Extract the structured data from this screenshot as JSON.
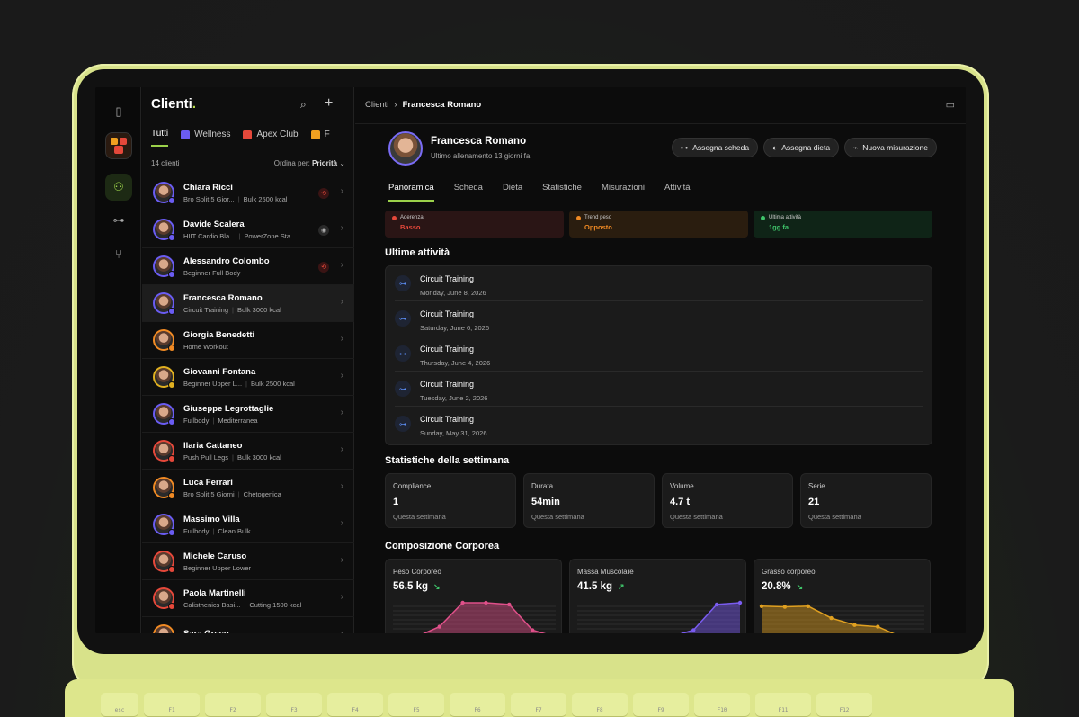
{
  "clients_pane": {
    "title": "Clienti",
    "title_dot": ".",
    "tabs": [
      {
        "label": "Tutti",
        "active": true
      },
      {
        "label": "Wellness",
        "color": "#6a5cf2"
      },
      {
        "label": "Apex Club",
        "color": "#e5483a"
      },
      {
        "label": "F",
        "color": "#f0a020"
      }
    ],
    "count": "14 clienti",
    "sort_label": "Ordina per:",
    "sort_value": "Priorità",
    "clients": [
      {
        "name": "Chiara Ricci",
        "plan": "Bro Split 5 Gior...",
        "diet": "Bulk 2500 kcal",
        "badge": "purple",
        "flag": "red"
      },
      {
        "name": "Davide Scalera",
        "plan": "HIIT Cardio Bla...",
        "diet": "PowerZone Sta...",
        "badge": "purple",
        "flag": "gray"
      },
      {
        "name": "Alessandro Colombo",
        "plan": "Beginner Full Body",
        "diet": "",
        "badge": "purple",
        "flag": "red"
      },
      {
        "name": "Francesca Romano",
        "plan": "Circuit Training",
        "diet": "Bulk 3000 kcal",
        "badge": "purple",
        "flag": "",
        "selected": true
      },
      {
        "name": "Giorgia Benedetti",
        "plan": "Home Workout",
        "diet": "",
        "badge": "orange",
        "flag": ""
      },
      {
        "name": "Giovanni Fontana",
        "plan": "Beginner Upper L...",
        "diet": "Bulk 2500 kcal",
        "badge": "yellow",
        "flag": ""
      },
      {
        "name": "Giuseppe Legrottaglie",
        "plan": "Fullbody",
        "diet": "Mediterranea",
        "badge": "purple",
        "flag": ""
      },
      {
        "name": "Ilaria Cattaneo",
        "plan": "Push Pull Legs",
        "diet": "Bulk 3000 kcal",
        "badge": "red",
        "flag": ""
      },
      {
        "name": "Luca Ferrari",
        "plan": "Bro Split 5 Giorni",
        "diet": "Chetogenica",
        "badge": "orange",
        "flag": ""
      },
      {
        "name": "Massimo Villa",
        "plan": "Fullbody",
        "diet": "Clean Bulk",
        "badge": "purple",
        "flag": ""
      },
      {
        "name": "Michele Caruso",
        "plan": "Beginner Upper Lower",
        "diet": "",
        "badge": "red",
        "flag": ""
      },
      {
        "name": "Paola Martinelli",
        "plan": "Calisthenics Basi...",
        "diet": "Cutting 1500 kcal",
        "badge": "red",
        "flag": ""
      },
      {
        "name": "Sara Greco",
        "plan": "",
        "diet": "",
        "badge": "orange",
        "flag": ""
      }
    ]
  },
  "breadcrumb": {
    "root": "Clienti",
    "current": "Francesca Romano"
  },
  "profile": {
    "name": "Francesca Romano",
    "last_workout": "Ultimo allenamento 13 giorni fa",
    "actions": [
      "Assegna scheda",
      "Assegna dieta",
      "Nuova misurazione"
    ],
    "tabs": [
      "Panoramica",
      "Scheda",
      "Dieta",
      "Statistiche",
      "Misurazioni",
      "Attività"
    ]
  },
  "status_cards": [
    {
      "label": "Aderenza",
      "value": "Basso",
      "color": "#e5483a",
      "bg": "#2a1515"
    },
    {
      "label": "Trend peso",
      "value": "Opposto",
      "color": "#f08a24",
      "bg": "#2a1d0f"
    },
    {
      "label": "Ultima attività",
      "value": "1gg fa",
      "color": "#3fc46a",
      "bg": "#0f2417"
    }
  ],
  "activities_title": "Ultime attività",
  "activities": [
    {
      "title": "Circuit Training",
      "date": "Monday, June 8, 2026"
    },
    {
      "title": "Circuit Training",
      "date": "Saturday, June 6, 2026"
    },
    {
      "title": "Circuit Training",
      "date": "Thursday, June 4, 2026"
    },
    {
      "title": "Circuit Training",
      "date": "Tuesday, June 2, 2026"
    },
    {
      "title": "Circuit Training",
      "date": "Sunday, May 31, 2026"
    }
  ],
  "week_title": "Statistiche della settimana",
  "week_stats": [
    {
      "label": "Compliance",
      "value": "1",
      "sub": "Questa settimana"
    },
    {
      "label": "Durata",
      "value": "54min",
      "sub": "Questa settimana"
    },
    {
      "label": "Volume",
      "value": "4.7 t",
      "sub": "Questa settimana"
    },
    {
      "label": "Serie",
      "value": "21",
      "sub": "Questa settimana"
    }
  ],
  "body_title": "Composizione Corporea",
  "body_stats": [
    {
      "label": "Peso Corporeo",
      "value": "56.5 kg",
      "trend": "down",
      "color": "#e0508a",
      "points": [
        0,
        0,
        0.3,
        1,
        1,
        0.95,
        0.2,
        0
      ]
    },
    {
      "label": "Massa Muscolare",
      "value": "41.5 kg",
      "trend": "up",
      "color": "#7a5cf0",
      "points": [
        0,
        0,
        0,
        0,
        0,
        0.2,
        0.95,
        1
      ]
    },
    {
      "label": "Grasso corporeo",
      "value": "20.8%",
      "trend": "down",
      "color": "#e0a020",
      "points": [
        0.9,
        0.88,
        0.9,
        0.55,
        0.35,
        0.3,
        0,
        0
      ]
    }
  ],
  "keyboard": [
    "esc",
    "F1",
    "F2",
    "F3",
    "F4",
    "F5",
    "F6",
    "F7",
    "F8",
    "F9",
    "F10",
    "F11",
    "F12"
  ]
}
